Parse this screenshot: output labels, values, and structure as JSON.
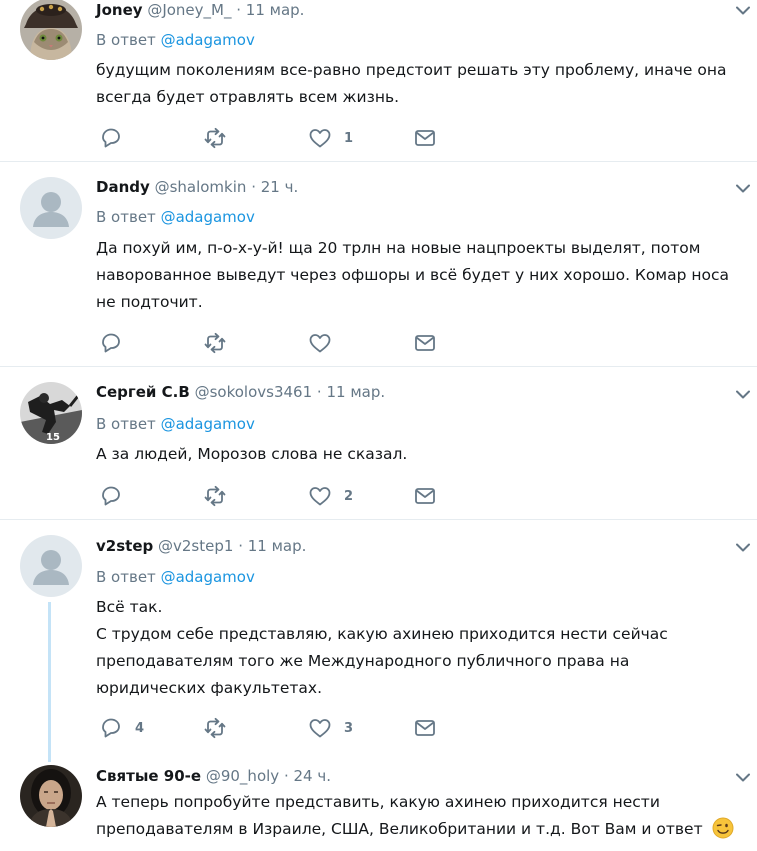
{
  "reply_prefix": "В ответ",
  "tweets": [
    {
      "name": "Joney",
      "handle": "@Joney_M_",
      "time": "11 мар.",
      "reply_to": "@adagamov",
      "lines": [
        "будущим поколениям все-равно предстоит решать эту проблему, иначе она",
        "всегда будет отравлять всем жизнь."
      ],
      "reply_count": "",
      "like_count": "1",
      "avatar": "cat-with-hat"
    },
    {
      "name": "Dandy",
      "handle": "@shalomkin",
      "time": "21 ч.",
      "reply_to": "@adagamov",
      "lines": [
        "Да похуй им, п-о-х-у-й! ща 20 трлн на новые нацпроекты выделят, потом",
        "наворованное выведут через офшоры и всё будет у них хорошо. Комар носа",
        "не подточит."
      ],
      "reply_count": "",
      "like_count": "",
      "avatar": "default"
    },
    {
      "name": "Сергей С.В",
      "handle": "@sokolovs3461",
      "time": "11 мар.",
      "reply_to": "@adagamov",
      "lines": [
        "А за людей, Морозов слова не сказал."
      ],
      "reply_count": "",
      "like_count": "2",
      "avatar": "hockey-player"
    },
    {
      "name": "v2step",
      "handle": "@v2step1",
      "time": "11 мар.",
      "reply_to": "@adagamov",
      "lines": [
        "Всё так.",
        "С трудом себе представляю, какую ахинею приходится нести сейчас",
        "преподавателям того же Международного публичного права на",
        "юридических факультетах."
      ],
      "reply_count": "4",
      "like_count": "3",
      "avatar": "default"
    },
    {
      "name": "Святые 90-е",
      "handle": "@90_holy",
      "time": "24 ч.",
      "lines": [
        "А теперь попробуйте представить, какую ахинею приходится нести",
        "преподавателям в Израиле, США, Великобритании и т.д. Вот Вам и ответ"
      ],
      "emoji": "winking-face-emoji",
      "avatar": "praying-woman"
    }
  ],
  "colors": {
    "link": "#1b95e0",
    "muted": "#657786",
    "text": "#14171a",
    "thread": "#c4e3f7",
    "divider": "#e6ecf0"
  }
}
